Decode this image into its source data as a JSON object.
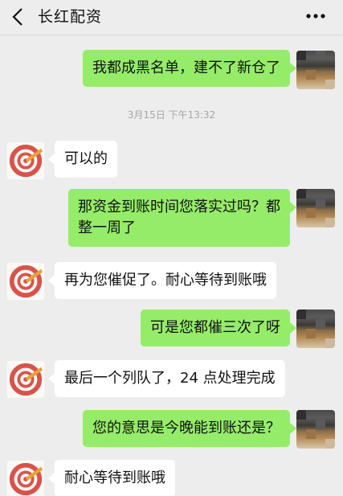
{
  "header": {
    "back_icon": "chevron-left-icon",
    "title": "长红配资",
    "more_icon": "more-dots-icon"
  },
  "timestamp": "3月15日 下午13:32",
  "messages": [
    {
      "sender": "self",
      "text": "我都成黑名单，建不了新仓了"
    },
    {
      "sender": "other",
      "text": "可以的"
    },
    {
      "sender": "self",
      "text": "那资金到账时间您落实过吗？都\n整一周了"
    },
    {
      "sender": "other",
      "text": "再为您催促了。耐心等待到账哦"
    },
    {
      "sender": "self",
      "text": "可是您都催三次了呀"
    },
    {
      "sender": "other",
      "text": "最后一个列队了，24 点处理完成"
    },
    {
      "sender": "self",
      "text": "您的意思是今晚能到账还是？"
    },
    {
      "sender": "other",
      "text": "耐心等待到账哦"
    }
  ],
  "colors": {
    "background": "#ededed",
    "self_bubble": "#95ec69",
    "other_bubble": "#ffffff",
    "avatar_target_red": "#d9534a"
  }
}
